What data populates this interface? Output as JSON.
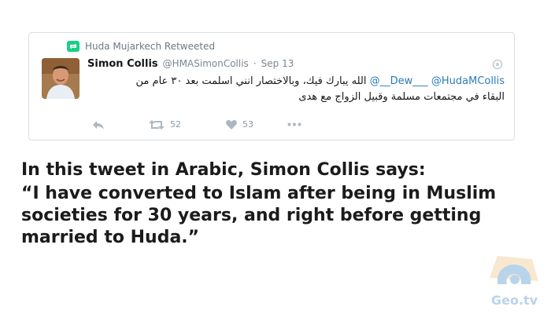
{
  "retweet": {
    "label": "Huda Mujarkech Retweeted",
    "color": "#19cf86"
  },
  "tweet": {
    "display_name": "Simon Collis",
    "handle": "@HMASimonCollis",
    "separator": "·",
    "date": "Sep 13",
    "mention_1": "@HudaMCollis",
    "mention_2": "@__Dew___",
    "text_line_1": "الله يبارك فيك، وبالاختصار انني اسلمت بعد ٣٠ عام من",
    "text_line_2": "البقاء في مجتمعات مسلمة وقبيل الزواج مع هدى",
    "actions": {
      "reply_icon": "reply-icon",
      "retweet_icon": "retweet-icon",
      "retweet_count": "52",
      "like_icon": "heart-icon",
      "like_count": "53",
      "more_icon": "more-icon"
    }
  },
  "caption": {
    "line_1": "In this tweet in Arabic, Simon Collis says:",
    "quote": "“I have converted to Islam after being in Muslim societies for 30 years, and right before getting married to Huda.”"
  },
  "watermark": {
    "text": "Geo.tv",
    "color": "#7fb2d9"
  }
}
